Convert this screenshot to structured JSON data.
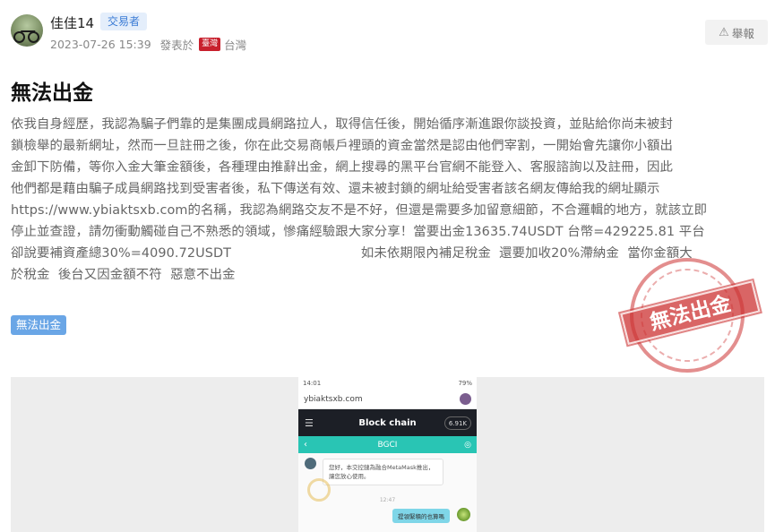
{
  "post": {
    "author": {
      "name": "佳佳14",
      "role": "交易者",
      "avatar_icon": "avatar-bicycle"
    },
    "timestamp": "2023-07-26 15:39",
    "posted_label": "發表於",
    "location_flag": "臺灣",
    "location": "台灣",
    "report_label": "舉報",
    "title": "無法出金",
    "body": "依我自身經歷，我認為騙子們靠的是集團成員網路拉人，取得信任後，開始循序漸進跟你談投資，並貼給你尚未被封\n鎖檢舉的最新網址，然而一旦註冊之後，你在此交易商帳戶裡頭的資金當然是認由他們宰割，一開始會先讓你小額出\n金卸下防備，等你入金大筆金額後，各種理由推辭出金，網上搜尋的黑平台官網不能登入、客服諮詢以及註冊，因此\n他們都是藉由騙子成員網路找到受害者後，私下傳送有效、還未被封鎖的網址給受害者該名網友傳給我的網址顯示\nhttps://www.ybiaktsxb.com的名稱，我認為網路交友不是不好，但還是需要多加留意細節，不合邏輯的地方，就該立即\n停止並查證，請勿衝動觸碰自己不熟悉的領域，慘痛經驗跟大家分享！當要出金13635.74USDT 台幣=429225.81 平台\n卻說要補資產總30%=4090.72USDT                               如未依期限內補足稅金  還要加收20%滯納金  當你金額大\n於稅金  後台又因金額不符  惡意不出金",
    "stamp_text": "無法出金",
    "tag": "無法出金"
  },
  "screenshot": {
    "status_time": "14:01",
    "status_right": "79%",
    "url": "ybiaktsxb.com",
    "app_title": "Block chain",
    "balance": "6.91K",
    "chat_title": "BGCI",
    "bot_message": "您好，本交控鏈為融合MetaMask推出，讓您放心使用。",
    "chat_time": "12:47",
    "user_message": "提領緊積的也算嗎"
  },
  "colors": {
    "role_badge": "#3a7bd5",
    "tag_bg": "#6aa6e6",
    "stamp": "#cc3232",
    "chat_header": "#29c5b4",
    "app_bar": "#1c1f26"
  }
}
